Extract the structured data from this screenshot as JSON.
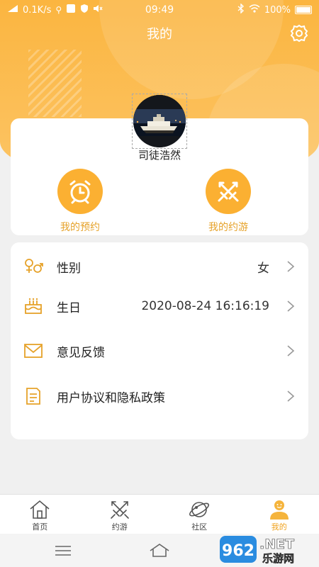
{
  "status_bar": {
    "network_speed": "0.1K/s",
    "time": "09:49",
    "battery": "100%"
  },
  "header": {
    "title": "我的"
  },
  "profile": {
    "username": "司徒浩然"
  },
  "actions": [
    {
      "label": "我的预约",
      "icon": "alarm-clock-icon"
    },
    {
      "label": "我的约游",
      "icon": "crossed-swords-icon"
    }
  ],
  "settings": [
    {
      "label": "性别",
      "value": "女",
      "icon": "gender-icon"
    },
    {
      "label": "生日",
      "value": "2020-08-24 16:16:19",
      "icon": "cake-icon"
    },
    {
      "label": "意见反馈",
      "value": "",
      "icon": "mail-icon"
    },
    {
      "label": "用户协议和隐私政策",
      "value": "",
      "icon": "document-icon"
    }
  ],
  "tabs": [
    {
      "label": "首页",
      "icon": "home-icon",
      "active": false
    },
    {
      "label": "约游",
      "icon": "crossed-swords-icon",
      "active": false
    },
    {
      "label": "社区",
      "icon": "planet-icon",
      "active": false
    },
    {
      "label": "我的",
      "icon": "user-icon",
      "active": true
    }
  ],
  "watermark": {
    "number": "962",
    "domain": ".NET",
    "site_name": "乐游网"
  },
  "colors": {
    "accent": "#fbb032",
    "accent_text": "#e6a22a",
    "active_tab": "#f0a21d"
  }
}
